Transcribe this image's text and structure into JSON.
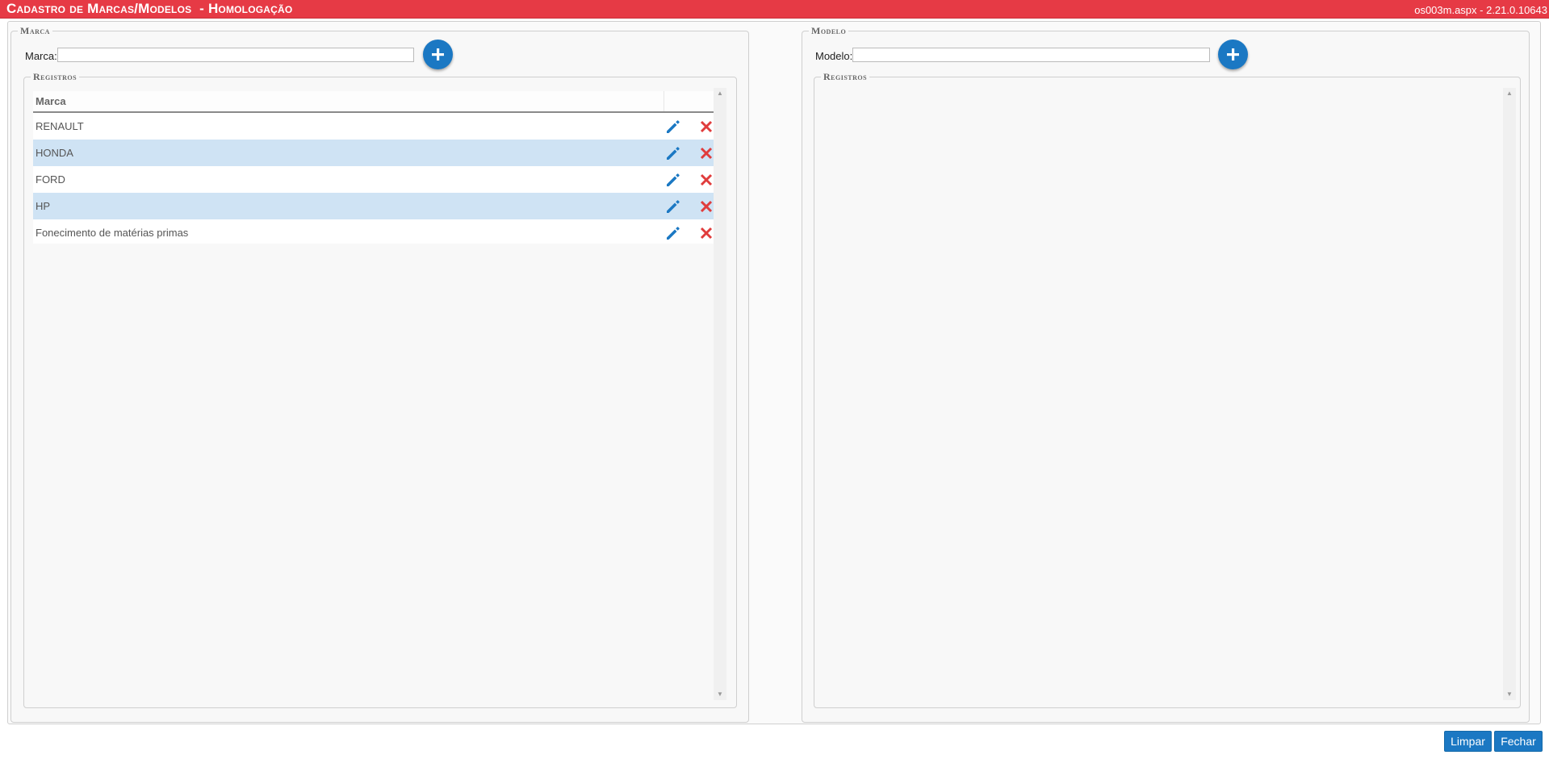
{
  "header": {
    "title": "Cadastro de Marcas/Modelos  - Homologação",
    "version": "os003m.aspx - 2.21.0.10643"
  },
  "marca_panel": {
    "legend": "Marca",
    "field_label": "Marca:",
    "field_value": "",
    "registros_legend": "Registros",
    "column_header": "Marca",
    "rows": [
      {
        "name": "RENAULT"
      },
      {
        "name": "HONDA"
      },
      {
        "name": "FORD"
      },
      {
        "name": "HP"
      },
      {
        "name": "Fonecimento de matérias primas"
      }
    ]
  },
  "modelo_panel": {
    "legend": "Modelo",
    "field_label": "Modelo:",
    "field_value": "",
    "registros_legend": "Registros"
  },
  "footer": {
    "limpar_label": "Limpar",
    "fechar_label": "Fechar"
  },
  "colors": {
    "title_bar": "#e63a45",
    "accent_blue": "#1b78c3",
    "row_alt": "#cfe3f4",
    "delete_red": "#e03c3c"
  },
  "icons": {
    "add": "plus-icon",
    "edit": "pencil-icon",
    "delete": "close-icon"
  }
}
